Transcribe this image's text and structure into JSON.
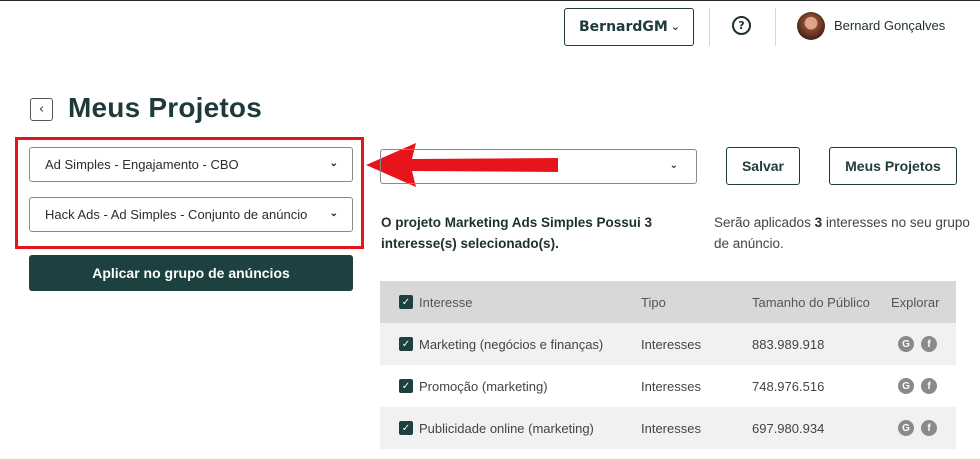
{
  "header": {
    "account_selector": "BernardGM",
    "user_name": "Bernard Gonçalves"
  },
  "page": {
    "title": "Meus Projetos"
  },
  "left_panel": {
    "campaign_dropdown": "Ad Simples - Engajamento - CBO",
    "adset_dropdown": "Hack Ads - Ad Simples - Conjunto de anúncio",
    "apply_button": "Aplicar no grupo de anúncios"
  },
  "right_panel": {
    "project_dropdown": "",
    "save_button": "Salvar",
    "my_projects_button": "Meus Projetos",
    "info_left": "O projeto Marketing Ads Simples Possui 3 interesse(s) selecionado(s).",
    "info_right_prefix": "Serão aplicados ",
    "info_right_count": "3",
    "info_right_suffix": " interesses no seu grupo de anúncio."
  },
  "table": {
    "headers": {
      "interest": "Interesse",
      "type": "Tipo",
      "audience": "Tamanho do Público",
      "explore": "Explorar"
    },
    "rows": [
      {
        "interest": "Marketing (negócios e finanças)",
        "type": "Interesses",
        "audience": "883.989.918"
      },
      {
        "interest": "Promoção (marketing)",
        "type": "Interesses",
        "audience": "748.976.516"
      },
      {
        "interest": "Publicidade online (marketing)",
        "type": "Interesses",
        "audience": "697.980.934"
      }
    ]
  },
  "colors": {
    "primary_dark": "#1d4040",
    "highlight_red": "#e8141c",
    "table_header_bg": "#d8d8d8"
  },
  "icons": [
    "chevron-down-icon",
    "help-icon",
    "chevron-left-icon",
    "checkbox-checked-icon",
    "google-icon",
    "facebook-icon"
  ]
}
